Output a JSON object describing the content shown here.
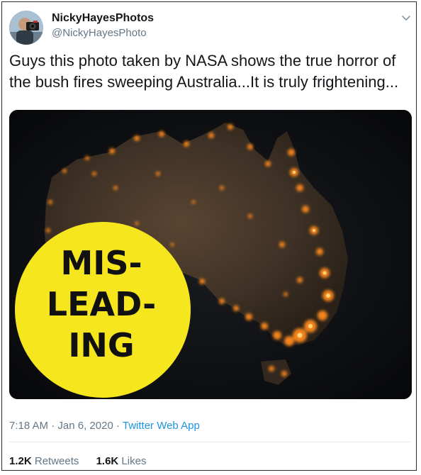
{
  "author": {
    "name": "NickyHayesPhotos",
    "handle": "@NickyHayesPhoto"
  },
  "tweet": {
    "text": "Guys this photo taken by NASA shows the true horror of the bush fires sweeping Australia...It is truly frightening..."
  },
  "image": {
    "stamp_lines": [
      "MIS-",
      "LEAD-",
      "ING"
    ],
    "stamp_color": "#f5e61e"
  },
  "meta": {
    "time": "7:18 AM",
    "sep1": " · ",
    "date": "Jan 6, 2020",
    "sep2": " · ",
    "app": "Twitter Web App"
  },
  "stats": {
    "retweets_count": "1.2K",
    "retweets_label": "Retweets",
    "likes_count": "1.6K",
    "likes_label": "Likes"
  },
  "icons": {
    "menu": "chevron-down-icon"
  }
}
